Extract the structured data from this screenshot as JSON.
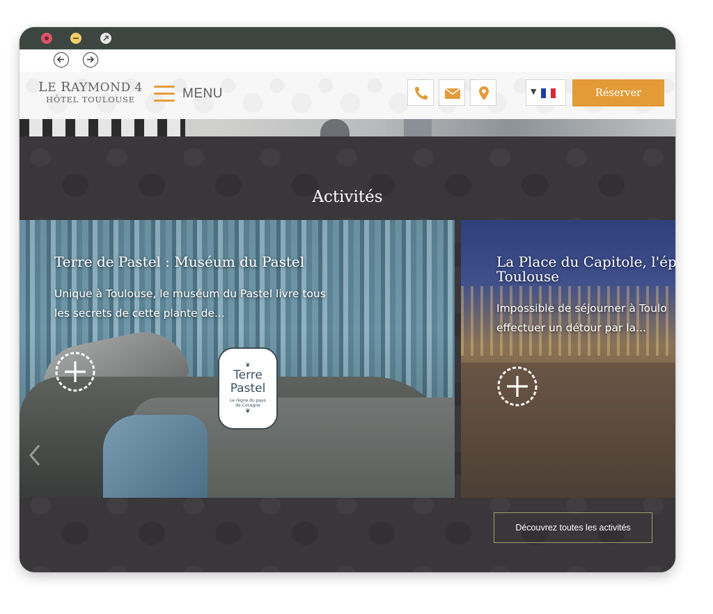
{
  "header": {
    "logo_line1_first": "L",
    "logo_line1_rest": "E ",
    "logo_line1_r": "R",
    "logo_line1_rest2": "AYMOND 4",
    "logo_line2": "HÔTEL TOULOUSE",
    "menu_label": "MENU",
    "reserve_label": "Réserver",
    "icons": [
      "phone-icon",
      "mail-icon",
      "location-pin-icon"
    ],
    "language_flag_colors": [
      "#1f3aa6",
      "#ffffff",
      "#d8293a"
    ],
    "accent_color": "#e29b37"
  },
  "section": {
    "title": "Activités",
    "cta_label": "Découvrez toutes les activités"
  },
  "cards": [
    {
      "title": "Terre de Pastel : Muséum du Pastel",
      "description": "Unique à Toulouse, le muséum du Pastel livre tous les secrets de cette plante de...",
      "badge_line1": "Terre",
      "badge_line2": "Pastel",
      "badge_line3": "Le règne du pays de Cocagne"
    },
    {
      "title_line1": "La Place du Capitole, l'ép",
      "title_line2": "Toulouse",
      "description_line1": "Impossible de séjourner à Toulo",
      "description_line2": "effectuer un détour par la..."
    }
  ]
}
